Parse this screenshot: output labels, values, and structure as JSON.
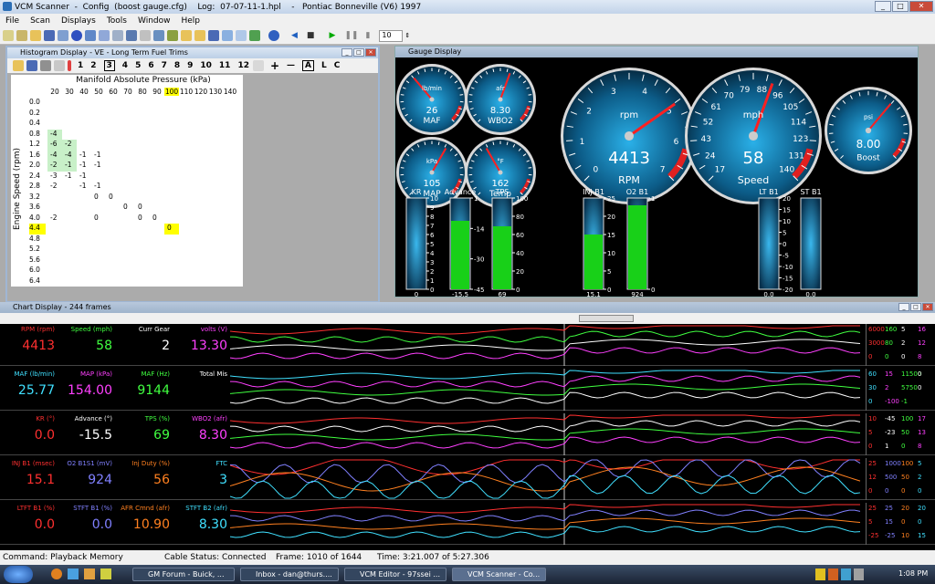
{
  "window": {
    "title": "VCM Scanner  -  Config  (boost gauge.cfg)    Log:  07-07-11-1.hpl    -   Pontiac Bonneville (V6) 1997"
  },
  "menu": [
    "File",
    "Scan",
    "Displays",
    "Tools",
    "Window",
    "Help"
  ],
  "toolbar": {
    "frame_value": "10"
  },
  "histogram": {
    "title": "Histogram Display  -  VE - Long Term Fuel Trims",
    "buttons": [
      "1",
      "2",
      "3",
      "4",
      "5",
      "6",
      "7",
      "8",
      "9",
      "10",
      "11",
      "12"
    ],
    "tool_labels": [
      "+",
      "—",
      "A",
      "L",
      "C"
    ],
    "x_axis_title": "Manifold Absolute Pressure (kPa)",
    "y_axis_title": "Engine Speed (rpm)",
    "columns": [
      "20",
      "30",
      "40",
      "50",
      "60",
      "70",
      "80",
      "90",
      "100",
      "110",
      "120",
      "130",
      "140"
    ],
    "rows": [
      "0.0",
      "0.2",
      "0.4",
      "0.8",
      "1.2",
      "1.6",
      "2.0",
      "2.4",
      "2.8",
      "3.2",
      "3.6",
      "4.0",
      "4.4",
      "4.8",
      "5.2",
      "5.6",
      "6.0",
      "6.4"
    ],
    "cells": [
      {
        "r": 3,
        "c": 0,
        "v": "-4"
      },
      {
        "r": 4,
        "c": 0,
        "v": "-6"
      },
      {
        "r": 4,
        "c": 1,
        "v": "-2"
      },
      {
        "r": 5,
        "c": 0,
        "v": "-4"
      },
      {
        "r": 5,
        "c": 1,
        "v": "-4"
      },
      {
        "r": 5,
        "c": 2,
        "v": "-1"
      },
      {
        "r": 5,
        "c": 3,
        "v": "-1"
      },
      {
        "r": 6,
        "c": 0,
        "v": "-2"
      },
      {
        "r": 6,
        "c": 1,
        "v": "-1"
      },
      {
        "r": 6,
        "c": 2,
        "v": "-1"
      },
      {
        "r": 6,
        "c": 3,
        "v": "-1"
      },
      {
        "r": 7,
        "c": 0,
        "v": "-3"
      },
      {
        "r": 7,
        "c": 1,
        "v": "-1"
      },
      {
        "r": 7,
        "c": 2,
        "v": "-1"
      },
      {
        "r": 8,
        "c": 0,
        "v": "-2"
      },
      {
        "r": 8,
        "c": 2,
        "v": "-1"
      },
      {
        "r": 8,
        "c": 3,
        "v": "-1"
      },
      {
        "r": 9,
        "c": 3,
        "v": "0"
      },
      {
        "r": 9,
        "c": 4,
        "v": "0"
      },
      {
        "r": 10,
        "c": 5,
        "v": "0"
      },
      {
        "r": 10,
        "c": 6,
        "v": "0"
      },
      {
        "r": 11,
        "c": 0,
        "v": "-2"
      },
      {
        "r": 11,
        "c": 3,
        "v": "0"
      },
      {
        "r": 11,
        "c": 6,
        "v": "0"
      },
      {
        "r": 11,
        "c": 7,
        "v": "0"
      },
      {
        "r": 12,
        "c": 8,
        "v": "0"
      }
    ]
  },
  "gauge_display": {
    "title": "Gauge Display",
    "dials": [
      {
        "id": "maf",
        "label": "MAF",
        "unit": "lb/min",
        "value": "26"
      },
      {
        "id": "wbo2",
        "label": "WBO2",
        "unit": "afr",
        "value": "8.30"
      },
      {
        "id": "map",
        "label": "MAP",
        "unit": "kPa",
        "value": "105"
      },
      {
        "id": "temp",
        "label": "Temp",
        "unit": "°F",
        "value": "162"
      },
      {
        "id": "rpm",
        "label": "RPM",
        "unit": "rpm",
        "value": "4413",
        "ticks": [
          "0",
          "1",
          "2",
          "3",
          "4",
          "5",
          "6",
          "7"
        ]
      },
      {
        "id": "speed",
        "label": "Speed",
        "unit": "mph",
        "value": "58",
        "ticks": [
          "17",
          "24",
          "43",
          "52",
          "61",
          "70",
          "79",
          "88",
          "96",
          "105",
          "114",
          "123",
          "131",
          "140"
        ]
      },
      {
        "id": "boost",
        "label": "Boost",
        "unit": "psi",
        "value": "8.00"
      }
    ],
    "bars": [
      {
        "label": "KR",
        "ticks": [
          "10",
          "9",
          "8",
          "7",
          "6",
          "5",
          "4",
          "3",
          "2",
          "1",
          "0"
        ],
        "bottom": "0",
        "level": 0
      },
      {
        "label": "Advance",
        "ticks": [
          "1",
          "-14",
          "-30",
          "-45"
        ],
        "bottom": "-15.5",
        "level": 0.75
      },
      {
        "label": "TPS",
        "ticks": [
          "100",
          "80",
          "60",
          "40",
          "20",
          "0"
        ],
        "bottom": "69",
        "level": 0.69
      },
      {
        "label": "INJ B1",
        "ticks": [
          "25",
          "20",
          "15",
          "10",
          "5",
          "0"
        ],
        "bottom": "15.1",
        "level": 0.6
      },
      {
        "label": "O2 B1",
        "ticks": [
          "1",
          "0"
        ],
        "bottom": "924",
        "level": 0.92
      },
      {
        "label": "LT B1",
        "ticks": [
          "20",
          "15",
          "10",
          "5",
          "0",
          "-5",
          "-10",
          "-15",
          "-20"
        ],
        "bottom": "0.0",
        "level": 0
      },
      {
        "label": "ST B1",
        "ticks": [],
        "bottom": "0.0",
        "level": 0
      }
    ]
  },
  "chart_display": {
    "title": "Chart Display  -  244 frames",
    "rows": [
      {
        "cells": [
          {
            "label": "RPM (rpm)",
            "value": "4413",
            "color": "#ff3030"
          },
          {
            "label": "Speed (mph)",
            "value": "58",
            "color": "#40ff40"
          },
          {
            "label": "Curr Gear",
            "value": "2",
            "color": "#ffffff"
          },
          {
            "label": "volts (V)",
            "value": "13.30",
            "color": "#ff40ff"
          }
        ],
        "scales": [
          "6000",
          "160",
          "5",
          "16",
          "3000",
          "80",
          "2",
          "12",
          "0",
          "0",
          "0",
          "8"
        ]
      },
      {
        "cells": [
          {
            "label": "MAF (lb/min)",
            "value": "25.77",
            "color": "#40e0ff"
          },
          {
            "label": "MAP (kPa)",
            "value": "154.00",
            "color": "#ff40ff"
          },
          {
            "label": "MAF (Hz)",
            "value": "9144",
            "color": "#40ff40"
          },
          {
            "label": "Total Mis",
            "value": "",
            "color": "#ffffff"
          }
        ],
        "scales": [
          "60",
          "15",
          "11500",
          "0",
          "30",
          "2",
          "5750",
          "0",
          "0",
          "-100",
          "-1"
        ]
      },
      {
        "cells": [
          {
            "label": "KR (°)",
            "value": "0.0",
            "color": "#ff3030"
          },
          {
            "label": "Advance (°)",
            "value": "-15.5",
            "color": "#ffffff"
          },
          {
            "label": "TPS (%)",
            "value": "69",
            "color": "#40ff40"
          },
          {
            "label": "WBO2 (afr)",
            "value": "8.30",
            "color": "#ff40ff"
          }
        ],
        "scales": [
          "10",
          "-45",
          "100",
          "17",
          "5",
          "-23",
          "50",
          "13",
          "0",
          "1",
          "0",
          "8"
        ]
      },
      {
        "cells": [
          {
            "label": "INJ B1 (msec)",
            "value": "15.1",
            "color": "#ff3030"
          },
          {
            "label": "O2 B1S1 (mV)",
            "value": "924",
            "color": "#8080ff"
          },
          {
            "label": "Inj Duty (%)",
            "value": "56",
            "color": "#ff8020"
          },
          {
            "label": "FTC",
            "value": "3",
            "color": "#40e0ff"
          }
        ],
        "scales": [
          "25",
          "1000",
          "100",
          "5",
          "12",
          "500",
          "50",
          "2",
          "0",
          "0",
          "0",
          "0"
        ]
      },
      {
        "cells": [
          {
            "label": "LTFT B1 (%)",
            "value": "0.0",
            "color": "#ff3030"
          },
          {
            "label": "STFT B1 (%)",
            "value": "0.0",
            "color": "#8080ff"
          },
          {
            "label": "AFR Cmnd (afr)",
            "value": "10.90",
            "color": "#ff8020"
          },
          {
            "label": "STFT B2 (afr)",
            "value": "8.30",
            "color": "#40e0ff"
          }
        ],
        "scales": [
          "25",
          "25",
          "20",
          "20",
          "5",
          "15",
          "0",
          "0",
          "-25",
          "-25",
          "10",
          "15"
        ]
      }
    ]
  },
  "status": {
    "command": "Command:  Playback Memory",
    "cable": "Cable Status:  Connected",
    "frame": "Frame:  1010 of 1644",
    "time": "Time:  3:21.007 of 5:27.306"
  },
  "taskbar": {
    "items": [
      "GM Forum - Buick, ...",
      "Inbox - dan@thurs....",
      "VCM Editor - 97ssei ...",
      "VCM Scanner  -  Co..."
    ],
    "clock": "1:08 PM"
  },
  "colors": {
    "accent": "#3a9fd0",
    "bar_fill": "#18d018",
    "cell_green": "#c8f0c8",
    "cell_yellow": "#ffff00"
  }
}
